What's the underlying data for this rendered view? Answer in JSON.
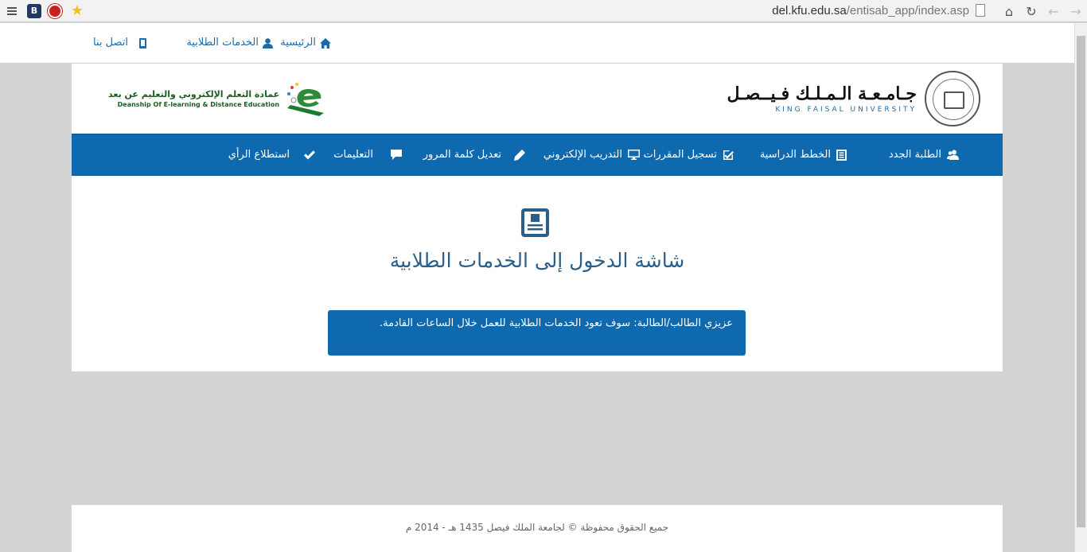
{
  "browser": {
    "url_domain": "del.kfu.edu.sa",
    "url_path": "/entisab_app/index.asp",
    "extensions": [
      "B"
    ]
  },
  "topnav": {
    "home": "الرئيسية",
    "services": "الخدمات الطلابية",
    "contact": "اتصل بنا"
  },
  "header": {
    "kfu_name_ar": "جـامـعـة الـمـلـك فـيــصـل",
    "kfu_name_en": "KING FAISAL UNIVERSITY",
    "del_name_ar": "عمادة التعلم الإلكتروني والتعليم عن بعد",
    "del_name_en": "Deanship Of E-learning & Distance Education"
  },
  "mainnav": {
    "new_students": "الطلبة الجدد",
    "study_plans": "الخطط الدراسية",
    "course_registration": "تسجيل المقررات",
    "e_training": "التدريب الإلكتروني",
    "change_password": "تعديل كلمة المرور",
    "instructions": "التعليمات",
    "survey": "استطلاع الرأي"
  },
  "content": {
    "title": "شاشة الدخول إلى الخدمات الطلابية",
    "alert": "عزيزي الطالب/الطالبة: سوف تعود الخدمات الطلابية للعمل خلال الساعات القادمة."
  },
  "footer": {
    "copyright": "جميع الحقوق محفوظة © لجامعة الملك فيصل 1435 هـ - 2014 م"
  },
  "colors": {
    "primary": "#0f69ae",
    "link": "#1c6ba8",
    "title": "#2a5f8c",
    "background": "#d3d3d3"
  }
}
